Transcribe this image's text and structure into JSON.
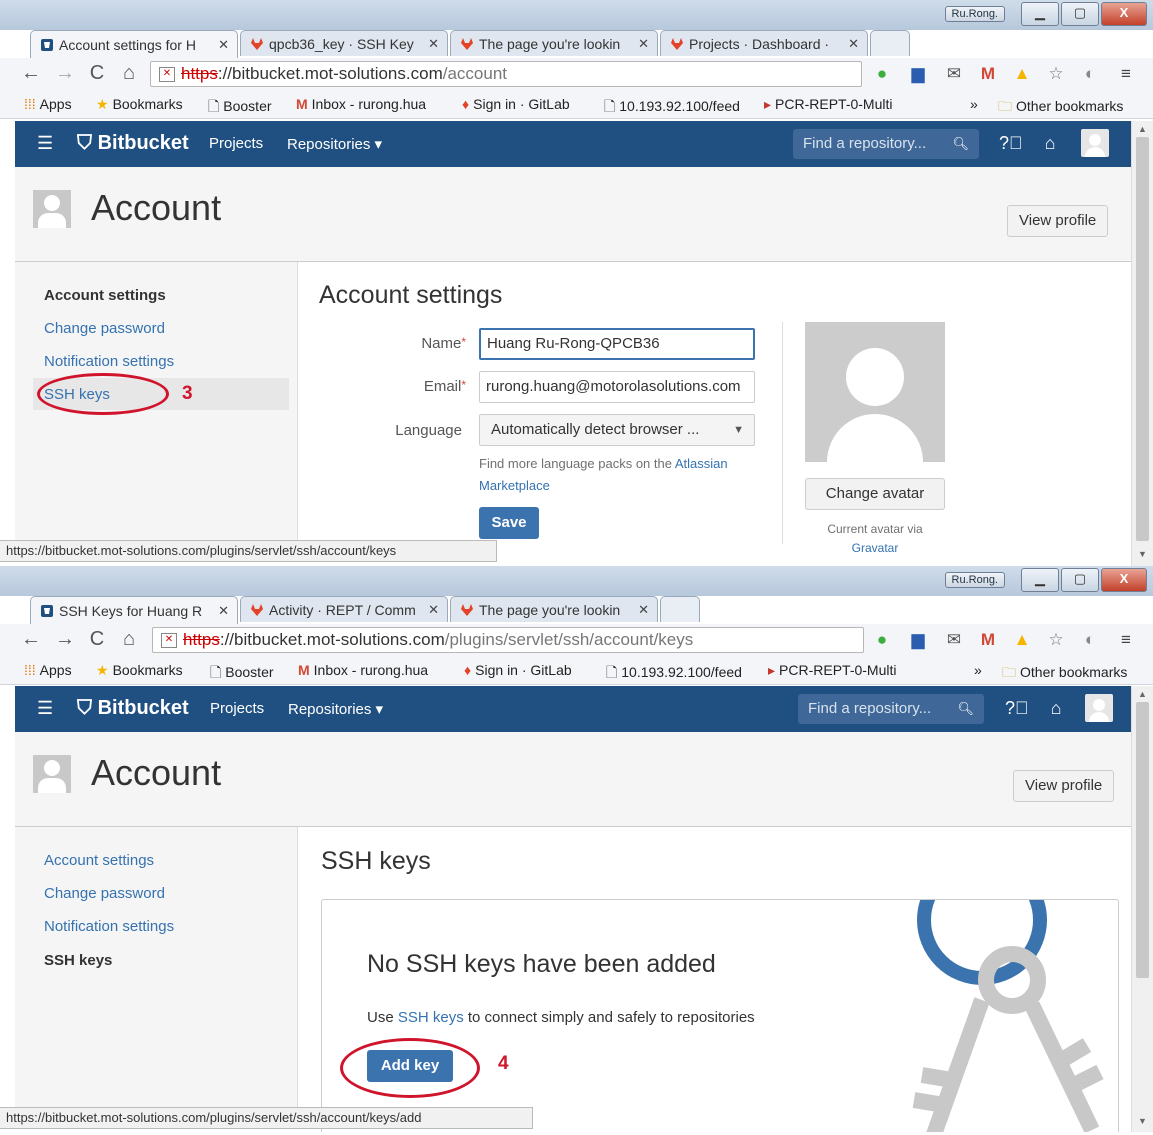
{
  "colors": {
    "bitbucket_blue": "#205081",
    "link": "#3572b0",
    "annotation_red": "#d0142c"
  },
  "window": {
    "user_badge": "Ru.Rong."
  },
  "bookmarks": {
    "apps": "Apps",
    "bookmarks": "Bookmarks",
    "booster": "Booster",
    "inbox": "Inbox - rurong.hua",
    "gitlab": "Sign in · GitLab",
    "feed": "10.193.92.100/feed",
    "pcr": "PCR-REPT-0-Multi",
    "more": "»",
    "other": "Other bookmarks"
  },
  "app": {
    "logo": "Bitbucket",
    "nav_projects": "Projects",
    "nav_repositories": "Repositories ▾",
    "search_placeholder": "Find a repository...",
    "page_title": "Account",
    "view_profile": "View profile",
    "sidebar": {
      "account_settings": "Account settings",
      "change_password": "Change password",
      "notification_settings": "Notification settings",
      "ssh_keys": "SSH keys"
    }
  },
  "shot1": {
    "tabs": [
      "Account settings for H",
      "qpcb36_key · SSH Key",
      "The page you're lookin",
      "Projects · Dashboard ·"
    ],
    "url_scheme": "https",
    "url_host": "://bitbucket.mot-solutions.com",
    "url_path": "/account",
    "heading": "Account settings",
    "name_label": "Name",
    "name_value": "Huang Ru-Rong-QPCB36",
    "email_label": "Email",
    "email_value": "rurong.huang@motorolasolutions.com",
    "language_label": "Language",
    "language_value": "Automatically detect browser ...",
    "help_prefix": "Find more language packs on the ",
    "help_link": "Atlassian Marketplace",
    "save": "Save",
    "change_avatar": "Change avatar",
    "avatar_caption": "Current avatar via",
    "gravatar": "Gravatar",
    "status_url": "https://bitbucket.mot-solutions.com/plugins/servlet/ssh/account/keys",
    "annotation": "3"
  },
  "shot2": {
    "tabs": [
      "SSH Keys for Huang R",
      "Activity · REPT / Comm",
      "The page you're lookin"
    ],
    "url_scheme": "https",
    "url_host": "://bitbucket.mot-solutions.com",
    "url_path": "/plugins/servlet/ssh/account/keys",
    "heading": "SSH keys",
    "empty_title": "No SSH keys have been added",
    "empty_prefix": "Use ",
    "empty_link": "SSH keys",
    "empty_suffix": " to connect simply and safely to repositories",
    "add_key": "Add key",
    "status_url": "https://bitbucket.mot-solutions.com/plugins/servlet/ssh/account/keys/add",
    "annotation": "4"
  }
}
